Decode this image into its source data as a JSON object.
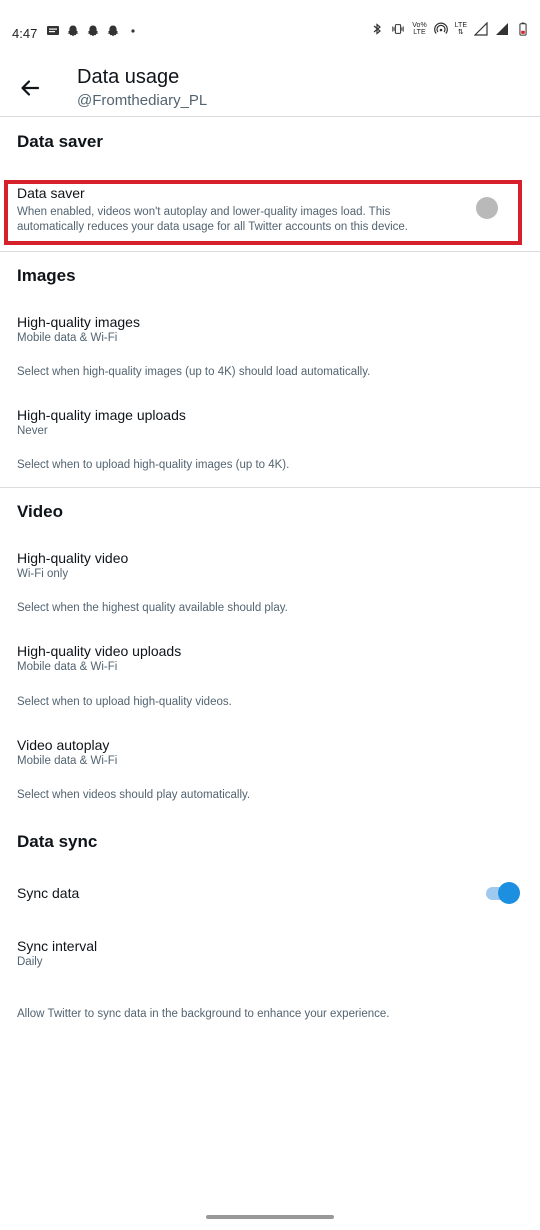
{
  "status_bar": {
    "time": "4:47",
    "right_labels": {
      "vowifi": "Vo%",
      "lte_small": "LTE",
      "lte": "LTE",
      "battery_r": "R"
    }
  },
  "app_bar": {
    "title": "Data usage",
    "subtitle": "@Fromthediary_PL"
  },
  "data_saver_section": {
    "header": "Data saver",
    "item": {
      "title": "Data saver",
      "description": "When enabled, videos won't autoplay and lower-quality images load. This automatically reduces your data usage for all Twitter accounts on this device.",
      "enabled": false
    }
  },
  "images_section": {
    "header": "Images",
    "items": [
      {
        "title": "High-quality images",
        "value": "Mobile data & Wi-Fi",
        "help": "Select when high-quality images (up to 4K) should load automatically."
      },
      {
        "title": "High-quality image uploads",
        "value": "Never",
        "help": "Select when to upload high-quality images (up to 4K)."
      }
    ]
  },
  "video_section": {
    "header": "Video",
    "items": [
      {
        "title": "High-quality video",
        "value": "Wi-Fi only",
        "help": "Select when the highest quality available should play."
      },
      {
        "title": "High-quality video uploads",
        "value": "Mobile data & Wi-Fi",
        "help": "Select when to upload high-quality videos."
      },
      {
        "title": "Video autoplay",
        "value": "Mobile data & Wi-Fi",
        "help": "Select when videos should play automatically."
      }
    ]
  },
  "data_sync_section": {
    "header": "Data sync",
    "sync_data": {
      "title": "Sync data",
      "enabled": true
    },
    "sync_interval": {
      "title": "Sync interval",
      "value": "Daily"
    },
    "help": "Allow Twitter to sync data in the background to enhance your experience."
  },
  "colors": {
    "accent": "#1d8fe0",
    "highlight": "#d6202b",
    "secondary_text": "#536471"
  }
}
